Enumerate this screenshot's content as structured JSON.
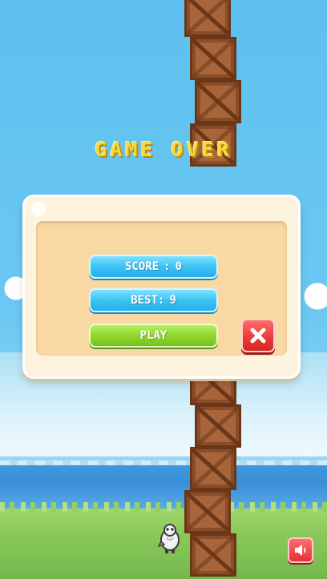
{
  "game": {
    "title": "GAME OVER",
    "score_label": "SCORE",
    "score_value": 0,
    "best_label": "BEST",
    "best_value": 9,
    "play_label": "PLAY"
  },
  "icons": {
    "close": "close-icon",
    "sound": "speaker-icon",
    "player": "bird-icon"
  },
  "colors": {
    "title": "#f6d73b",
    "blue_button": "#3cc3f5",
    "green_button": "#8fd72f",
    "red_button": "#ef3a3a",
    "panel": "#fdf3df",
    "crate": "#a8643a"
  }
}
